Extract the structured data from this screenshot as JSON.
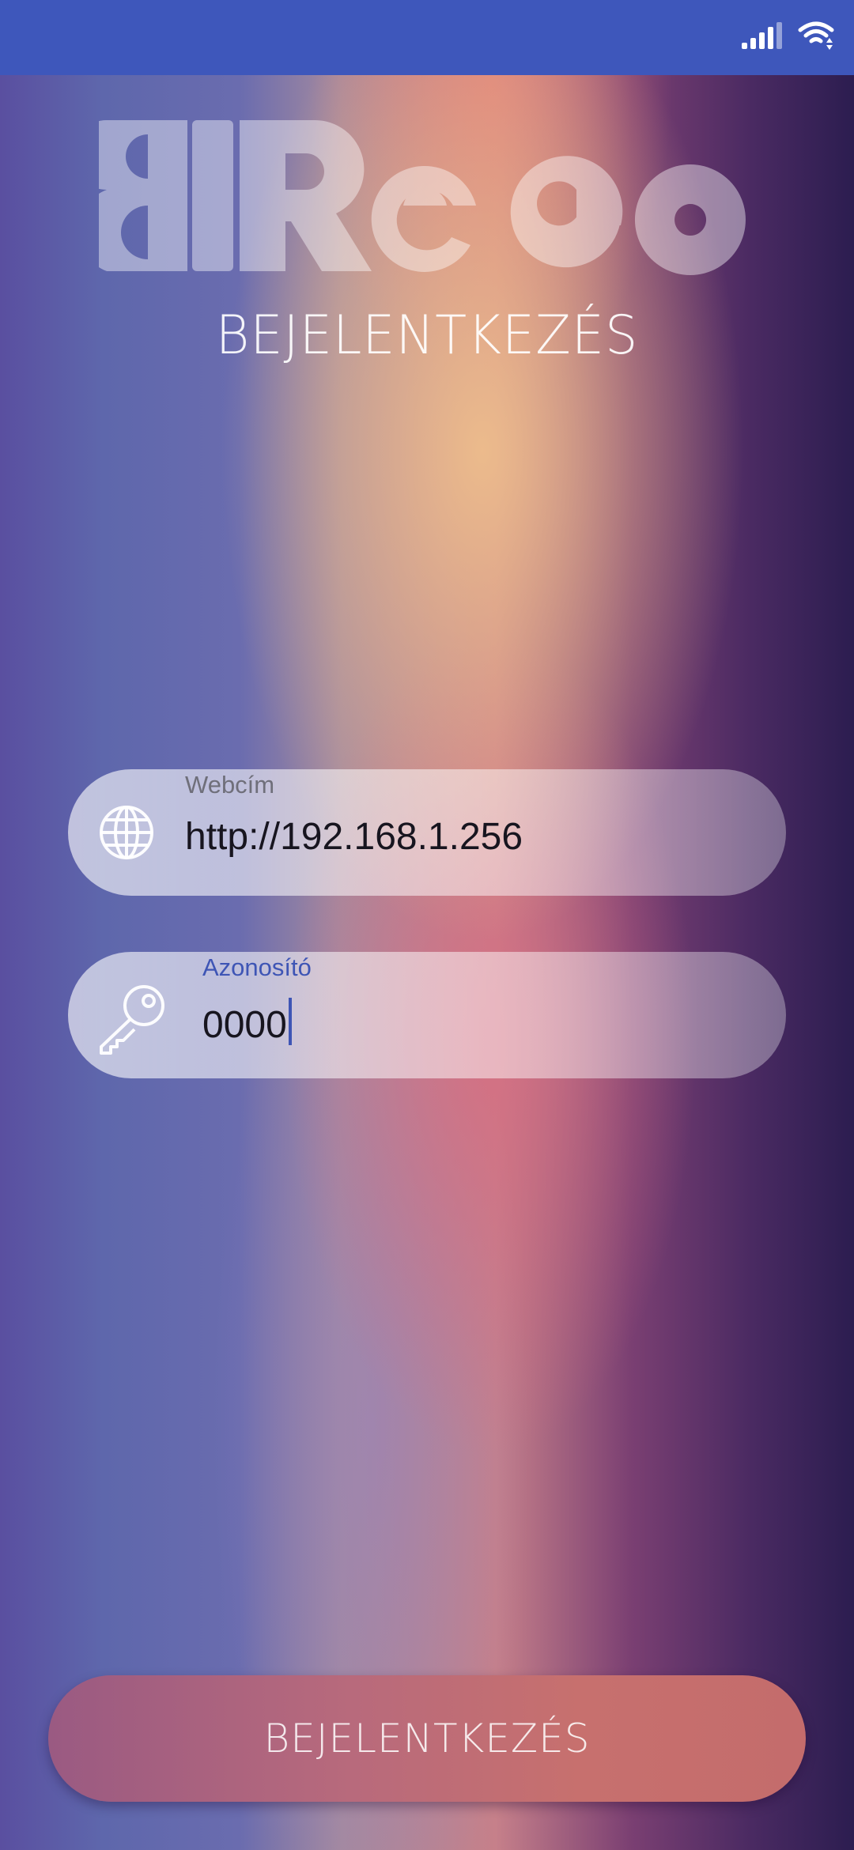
{
  "status_bar": {
    "background": "#3e57bb",
    "icons": [
      "signal-icon",
      "wifi-icon"
    ]
  },
  "logo": {
    "text": "Reco",
    "icon": "reco-logo"
  },
  "page": {
    "title": "BEJELENTKEZÉS"
  },
  "form": {
    "url": {
      "label": "Webcím",
      "value": "http://192.168.1.256",
      "icon": "globe-icon"
    },
    "id": {
      "label": "Azonosító",
      "value": "0000",
      "icon": "key-icon",
      "focused": true,
      "accent": "#3e55b5"
    }
  },
  "login_button": {
    "label": "BEJELENTKEZÉS"
  }
}
